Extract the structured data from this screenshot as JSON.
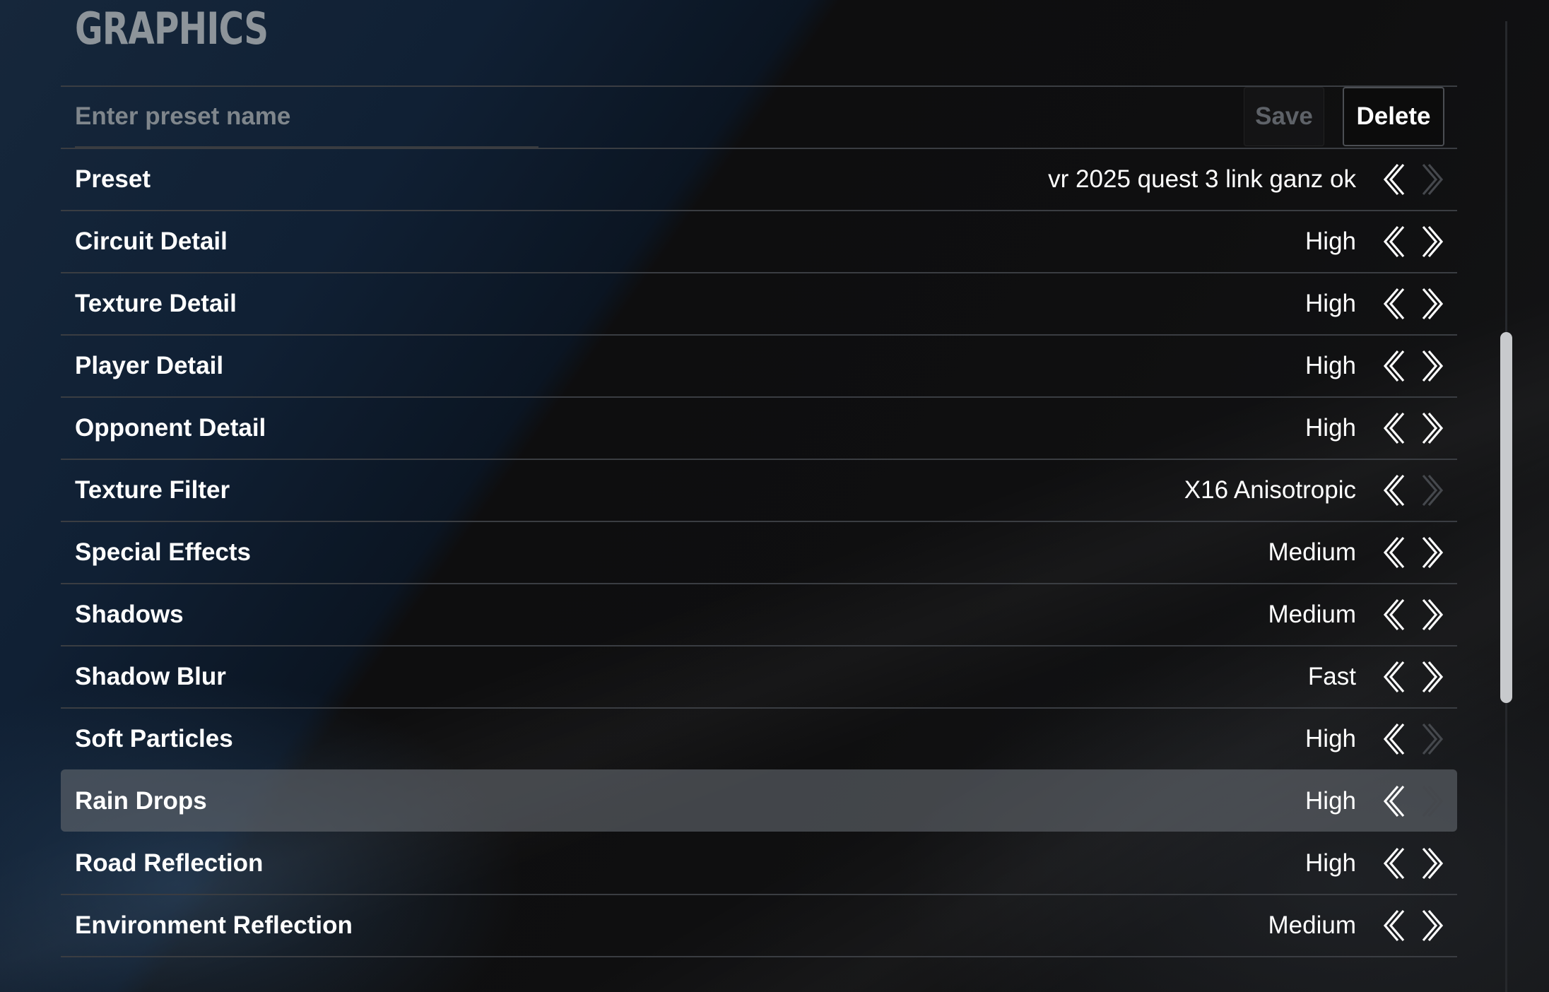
{
  "section": {
    "title": "GRAPHICS"
  },
  "preset_bar": {
    "input_placeholder": "Enter preset name",
    "input_value": "",
    "save_label": "Save",
    "save_enabled": false,
    "delete_label": "Delete"
  },
  "settings": [
    {
      "label": "Preset",
      "value": "vr 2025 quest 3 link ganz ok",
      "prev_enabled": true,
      "next_enabled": false,
      "selected": false
    },
    {
      "label": "Circuit Detail",
      "value": "High",
      "prev_enabled": true,
      "next_enabled": true,
      "selected": false
    },
    {
      "label": "Texture Detail",
      "value": "High",
      "prev_enabled": true,
      "next_enabled": true,
      "selected": false
    },
    {
      "label": "Player Detail",
      "value": "High",
      "prev_enabled": true,
      "next_enabled": true,
      "selected": false
    },
    {
      "label": "Opponent Detail",
      "value": "High",
      "prev_enabled": true,
      "next_enabled": true,
      "selected": false
    },
    {
      "label": "Texture Filter",
      "value": "X16 Anisotropic",
      "prev_enabled": true,
      "next_enabled": false,
      "selected": false
    },
    {
      "label": "Special Effects",
      "value": "Medium",
      "prev_enabled": true,
      "next_enabled": true,
      "selected": false
    },
    {
      "label": "Shadows",
      "value": "Medium",
      "prev_enabled": true,
      "next_enabled": true,
      "selected": false
    },
    {
      "label": "Shadow Blur",
      "value": "Fast",
      "prev_enabled": true,
      "next_enabled": true,
      "selected": false
    },
    {
      "label": "Soft Particles",
      "value": "High",
      "prev_enabled": true,
      "next_enabled": false,
      "selected": false
    },
    {
      "label": "Rain Drops",
      "value": "High",
      "prev_enabled": true,
      "next_enabled": false,
      "selected": true
    },
    {
      "label": "Road Reflection",
      "value": "High",
      "prev_enabled": true,
      "next_enabled": true,
      "selected": false
    },
    {
      "label": "Environment Reflection",
      "value": "Medium",
      "prev_enabled": true,
      "next_enabled": true,
      "selected": false
    }
  ],
  "icons": {
    "prev": "chevron-left-icon",
    "next": "chevron-right-icon"
  },
  "colors": {
    "text": "#ffffff",
    "muted": "#7f868c",
    "disabled_arrow": "#45484d",
    "selected_row": "#5f646b"
  }
}
